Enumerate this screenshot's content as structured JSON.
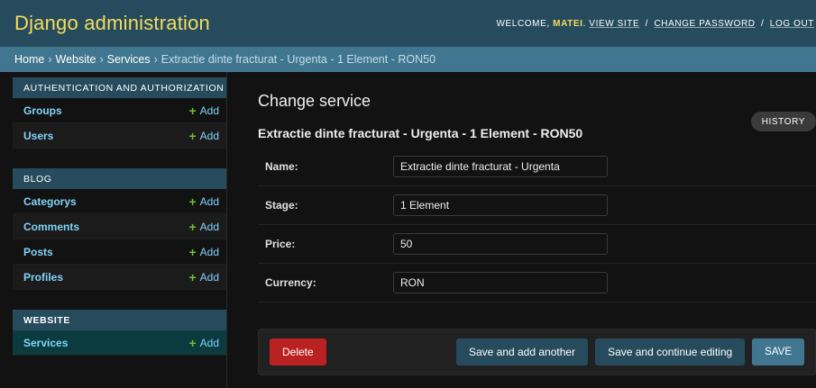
{
  "header": {
    "brand": "Django administration",
    "welcome": "WELCOME,",
    "user": "MATEI",
    "view_site": "VIEW SITE",
    "change_password": "CHANGE PASSWORD",
    "logout": "LOG OUT",
    "separator": "/"
  },
  "breadcrumbs": {
    "items": [
      "Home",
      "Website",
      "Services",
      "Extractie dinte fracturat - Urgenta - 1 Element - RON50"
    ],
    "separator": "›"
  },
  "sidebar": {
    "add_label": "Add",
    "modules": [
      {
        "caption": "Authentication and Authorization",
        "models": [
          "Groups",
          "Users"
        ]
      },
      {
        "caption": "Blog",
        "models": [
          "Categorys",
          "Comments",
          "Posts",
          "Profiles"
        ]
      },
      {
        "caption": "Website",
        "models": [
          "Services"
        ]
      }
    ]
  },
  "main": {
    "page_title": "Change service",
    "history_label": "History",
    "object_title": "Extractie dinte fracturat - Urgenta - 1 Element - RON50",
    "fields": [
      {
        "label": "Name:",
        "value": "Extractie dinte fracturat - Urgenta"
      },
      {
        "label": "Stage:",
        "value": "1 Element"
      },
      {
        "label": "Price:",
        "value": "50"
      },
      {
        "label": "Currency:",
        "value": "RON"
      }
    ],
    "buttons": {
      "delete": "Delete",
      "save_add_another": "Save and add another",
      "save_continue": "Save and continue editing",
      "save": "SAVE"
    }
  },
  "colors": {
    "header_bg": "#264b5d",
    "brand": "#f5dd5d",
    "breadcrumbs_bg": "#417690",
    "link": "#81d4fa",
    "add_plus": "#70bf2b",
    "delete": "#ba2121"
  },
  "icons": {
    "add": "plus-icon"
  }
}
